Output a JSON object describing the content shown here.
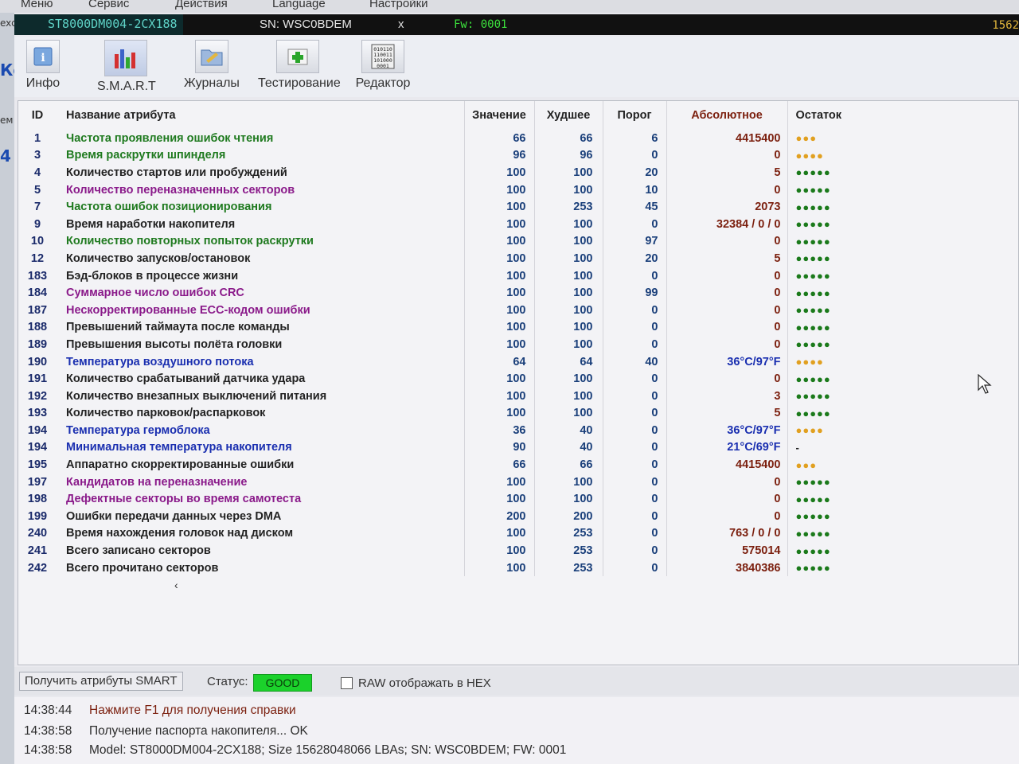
{
  "menu": [
    "Меню",
    "Сервис",
    "Действия",
    "Language",
    "Настройки"
  ],
  "left_strip": [
    "exc",
    "Ко",
    "ем",
    "4"
  ],
  "device": {
    "model": "ST8000DM004-2CX188",
    "sn": "SN: WSC0BDEM",
    "close": "x",
    "fw": "Fw: 0001",
    "right_value": "1562"
  },
  "toolbar": [
    {
      "label": "Инфо",
      "icon": "info-icon"
    },
    {
      "label": "S.M.A.R.T",
      "icon": "smart-chart-icon"
    },
    {
      "label": "Журналы",
      "icon": "logs-folder-icon"
    },
    {
      "label": "Тестирование",
      "icon": "test-plus-icon"
    },
    {
      "label": "Редактор",
      "icon": "hex-editor-icon"
    }
  ],
  "table": {
    "headers": {
      "id": "ID",
      "name": "Название атрибута",
      "value": "Значение",
      "worst": "Худшее",
      "threshold": "Порог",
      "raw": "Абсолютное",
      "remaining": "Остаток"
    },
    "rows": [
      {
        "id": "1",
        "name": "Частота проявления ошибок чтения",
        "value": "66",
        "worst": "66",
        "thr": "6",
        "raw": "4415400",
        "rem": "●●●",
        "color": "#1f7a1f",
        "rem_color": "#e1a020"
      },
      {
        "id": "3",
        "name": "Время раскрутки шпинделя",
        "value": "96",
        "worst": "96",
        "thr": "0",
        "raw": "0",
        "rem": "●●●●",
        "color": "#1f7a1f",
        "rem_color": "#e1a020"
      },
      {
        "id": "4",
        "name": "Количество стартов или пробуждений",
        "value": "100",
        "worst": "100",
        "thr": "20",
        "raw": "5",
        "rem": "●●●●●",
        "color": "#222222",
        "rem_color": "#1b7a1b"
      },
      {
        "id": "5",
        "name": "Количество переназначенных секторов",
        "value": "100",
        "worst": "100",
        "thr": "10",
        "raw": "0",
        "rem": "●●●●●",
        "color": "#8a1a8a",
        "rem_color": "#1b7a1b"
      },
      {
        "id": "7",
        "name": "Частота ошибок позиционирования",
        "value": "100",
        "worst": "253",
        "thr": "45",
        "raw": "2073",
        "rem": "●●●●●",
        "color": "#1f7a1f",
        "rem_color": "#1b7a1b"
      },
      {
        "id": "9",
        "name": "Время наработки накопителя",
        "value": "100",
        "worst": "100",
        "thr": "0",
        "raw": "32384 / 0 / 0",
        "rem": "●●●●●",
        "color": "#222222",
        "rem_color": "#1b7a1b"
      },
      {
        "id": "10",
        "name": "Количество повторных попыток раскрутки",
        "value": "100",
        "worst": "100",
        "thr": "97",
        "raw": "0",
        "rem": "●●●●●",
        "color": "#1f7a1f",
        "rem_color": "#1b7a1b"
      },
      {
        "id": "12",
        "name": "Количество запусков/остановок",
        "value": "100",
        "worst": "100",
        "thr": "20",
        "raw": "5",
        "rem": "●●●●●",
        "color": "#222222",
        "rem_color": "#1b7a1b"
      },
      {
        "id": "183",
        "name": "Бэд-блоков в процессе жизни",
        "value": "100",
        "worst": "100",
        "thr": "0",
        "raw": "0",
        "rem": "●●●●●",
        "color": "#222222",
        "rem_color": "#1b7a1b"
      },
      {
        "id": "184",
        "name": "Суммарное число ошибок CRC",
        "value": "100",
        "worst": "100",
        "thr": "99",
        "raw": "0",
        "rem": "●●●●●",
        "color": "#8a1a8a",
        "rem_color": "#1b7a1b"
      },
      {
        "id": "187",
        "name": "Нескорректированные ECC-кодом ошибки",
        "value": "100",
        "worst": "100",
        "thr": "0",
        "raw": "0",
        "rem": "●●●●●",
        "color": "#8a1a8a",
        "rem_color": "#1b7a1b"
      },
      {
        "id": "188",
        "name": "Превышений таймаута после команды",
        "value": "100",
        "worst": "100",
        "thr": "0",
        "raw": "0",
        "rem": "●●●●●",
        "color": "#222222",
        "rem_color": "#1b7a1b"
      },
      {
        "id": "189",
        "name": "Превышения высоты полёта головки",
        "value": "100",
        "worst": "100",
        "thr": "0",
        "raw": "0",
        "rem": "●●●●●",
        "color": "#222222",
        "rem_color": "#1b7a1b"
      },
      {
        "id": "190",
        "name": "Температура воздушного потока",
        "value": "64",
        "worst": "64",
        "thr": "40",
        "raw": "36°C/97°F",
        "rem": "●●●●",
        "color": "#1a2fb0",
        "rem_color": "#e1a020",
        "raw_color": "#1a2fb0"
      },
      {
        "id": "191",
        "name": "Количество срабатываний датчика удара",
        "value": "100",
        "worst": "100",
        "thr": "0",
        "raw": "0",
        "rem": "●●●●●",
        "color": "#222222",
        "rem_color": "#1b7a1b"
      },
      {
        "id": "192",
        "name": "Количество внезапных выключений питания",
        "value": "100",
        "worst": "100",
        "thr": "0",
        "raw": "3",
        "rem": "●●●●●",
        "color": "#222222",
        "rem_color": "#1b7a1b"
      },
      {
        "id": "193",
        "name": "Количество парковок/распарковок",
        "value": "100",
        "worst": "100",
        "thr": "0",
        "raw": "5",
        "rem": "●●●●●",
        "color": "#222222",
        "rem_color": "#1b7a1b"
      },
      {
        "id": "194",
        "name": "Температура гермоблока",
        "value": "36",
        "worst": "40",
        "thr": "0",
        "raw": "36°C/97°F",
        "rem": "●●●●",
        "color": "#1a2fb0",
        "rem_color": "#e1a020",
        "raw_color": "#1a2fb0"
      },
      {
        "id": "194",
        "name": "Минимальная температура накопителя",
        "value": "90",
        "worst": "40",
        "thr": "0",
        "raw": "21°C/69°F",
        "rem": "-",
        "color": "#1a2fb0",
        "rem_color": "#222222",
        "raw_color": "#1a2fb0"
      },
      {
        "id": "195",
        "name": "Аппаратно скорректированные ошибки",
        "value": "66",
        "worst": "66",
        "thr": "0",
        "raw": "4415400",
        "rem": "●●●",
        "color": "#222222",
        "rem_color": "#e1a020"
      },
      {
        "id": "197",
        "name": "Кандидатов на переназначение",
        "value": "100",
        "worst": "100",
        "thr": "0",
        "raw": "0",
        "rem": "●●●●●",
        "color": "#8a1a8a",
        "rem_color": "#1b7a1b"
      },
      {
        "id": "198",
        "name": "Дефектные секторы во время самотеста",
        "value": "100",
        "worst": "100",
        "thr": "0",
        "raw": "0",
        "rem": "●●●●●",
        "color": "#8a1a8a",
        "rem_color": "#1b7a1b"
      },
      {
        "id": "199",
        "name": "Ошибки передачи данных через DMA",
        "value": "200",
        "worst": "200",
        "thr": "0",
        "raw": "0",
        "rem": "●●●●●",
        "color": "#222222",
        "rem_color": "#1b7a1b"
      },
      {
        "id": "240",
        "name": "Время нахождения головок над диском",
        "value": "100",
        "worst": "253",
        "thr": "0",
        "raw": "763 / 0 / 0",
        "rem": "●●●●●",
        "color": "#222222",
        "rem_color": "#1b7a1b"
      },
      {
        "id": "241",
        "name": "Всего записано секторов",
        "value": "100",
        "worst": "253",
        "thr": "0",
        "raw": "575014",
        "rem": "●●●●●",
        "color": "#222222",
        "rem_color": "#1b7a1b"
      },
      {
        "id": "242",
        "name": "Всего прочитано секторов",
        "value": "100",
        "worst": "253",
        "thr": "0",
        "raw": "3840386",
        "rem": "●●●●●",
        "color": "#222222",
        "rem_color": "#1b7a1b"
      }
    ]
  },
  "status": {
    "get_button": "Получить атрибуты SMART",
    "label": "Статус:",
    "badge": "GOOD",
    "badge_color": "#1bd12b",
    "raw_hex_label": "RAW отображать в HEX",
    "raw_hex_checked": false
  },
  "log": [
    {
      "time": "14:38:44",
      "text": "Нажмите F1 для получения справки",
      "color": "#7b1f0e"
    },
    {
      "time": "14:38:58",
      "text": "Получение паспорта накопителя... OK",
      "color": "#2d2d2d"
    },
    {
      "time": "14:38:58",
      "text": "Model: ST8000DM004-2CX188; Size 15628048066 LBAs; SN: WSC0BDEM; FW: 0001",
      "color": "#2d2d2d"
    }
  ]
}
